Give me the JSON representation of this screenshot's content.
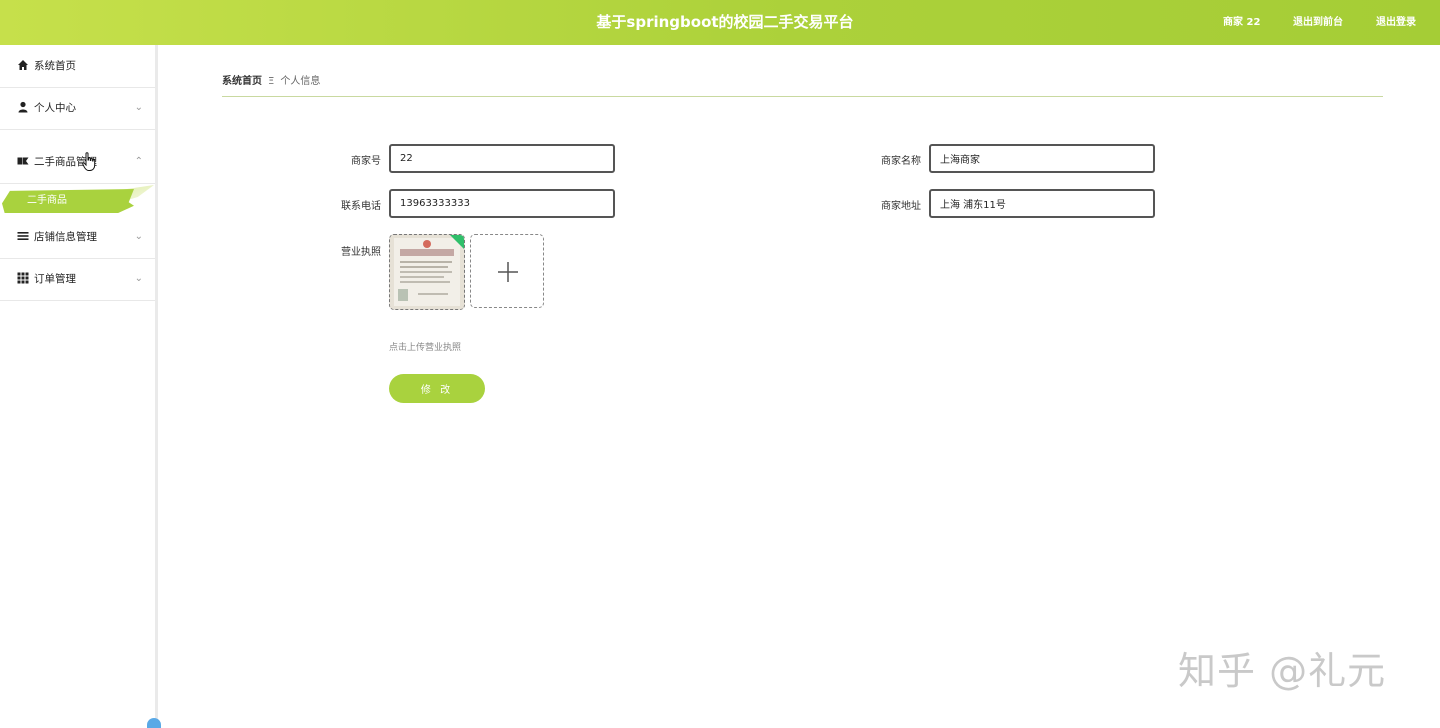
{
  "header": {
    "title": "基于springboot的校园二手交易平台",
    "user_label": "商家 22",
    "back_label": "退出到前台",
    "logout_label": "退出登录",
    "color": "#a9d23e"
  },
  "sidebar": {
    "items": [
      {
        "label": "系统首页",
        "icon": "home-icon"
      },
      {
        "label": "个人中心",
        "icon": "user-icon",
        "chevron": "⌄"
      },
      {
        "label": "二手商品管理",
        "icon": "goods-icon",
        "chevron": "⌃"
      },
      {
        "label": "店铺信息管理",
        "icon": "list-icon",
        "chevron": "⌄"
      },
      {
        "label": "订单管理",
        "icon": "grid-icon",
        "chevron": "⌄"
      }
    ],
    "sub_item": {
      "label": "二手商品"
    }
  },
  "breadcrumb": {
    "home": "系统首页",
    "separator": "Ξ",
    "current": "个人信息"
  },
  "form": {
    "merchant_no_label": "商家号",
    "merchant_no_value": "22",
    "merchant_name_label": "商家名称",
    "merchant_name_value": "上海商家",
    "phone_label": "联系电话",
    "phone_value": "13963333333",
    "address_label": "商家地址",
    "address_value": "上海 浦东11号",
    "license_label": "营业执照",
    "upload_tip": "点击上传营业执照",
    "submit_label": "修 改"
  },
  "watermark": "知乎 @礼元"
}
